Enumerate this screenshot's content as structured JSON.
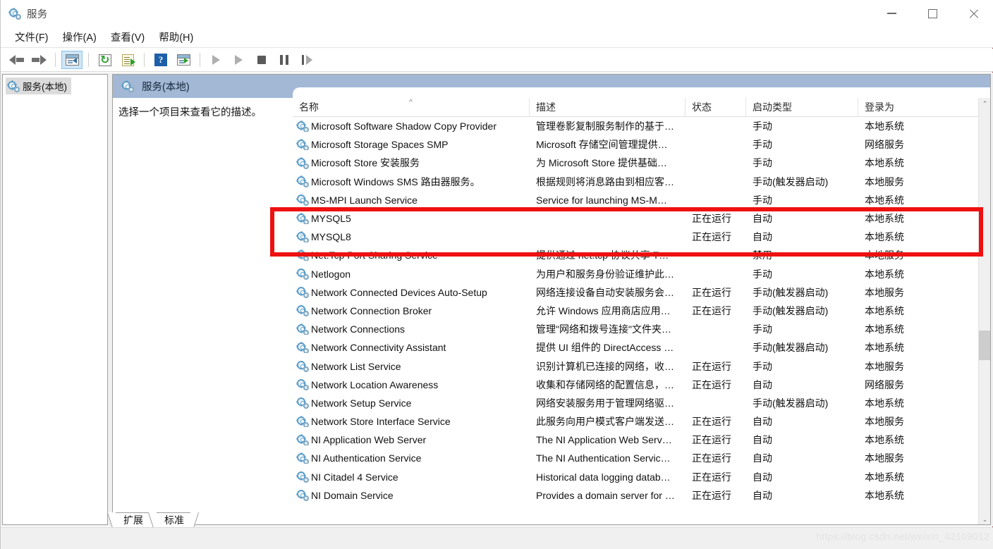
{
  "window": {
    "title": "服务",
    "icon": "services-gear-icon",
    "controls": {
      "minimize": "最小化",
      "maximize": "最大化",
      "close": "关闭"
    }
  },
  "menubar": {
    "items": [
      {
        "label": "文件(F)",
        "name": "menu-file"
      },
      {
        "label": "操作(A)",
        "name": "menu-action"
      },
      {
        "label": "查看(V)",
        "name": "menu-view"
      },
      {
        "label": "帮助(H)",
        "name": "menu-help"
      }
    ]
  },
  "toolbar": {
    "buttons": [
      {
        "name": "back-arrow-icon",
        "glyph": "left-arrow"
      },
      {
        "name": "forward-arrow-icon",
        "glyph": "right-arrow"
      },
      {
        "name": "show-hide-console-tree-icon",
        "glyph": "window-pane",
        "active": true
      },
      {
        "name": "refresh-icon",
        "glyph": "refresh"
      },
      {
        "name": "export-list-icon",
        "glyph": "export"
      },
      {
        "name": "help-icon",
        "glyph": "help"
      },
      {
        "name": "properties-icon",
        "glyph": "window-play"
      },
      {
        "name": "start-service-icon",
        "glyph": "play"
      },
      {
        "name": "resume-service-icon",
        "glyph": "play-outline"
      },
      {
        "name": "stop-service-icon",
        "glyph": "stop"
      },
      {
        "name": "pause-service-icon",
        "glyph": "pause"
      },
      {
        "name": "restart-service-icon",
        "glyph": "step"
      }
    ]
  },
  "tree": {
    "root_label": "服务(本地)"
  },
  "detail": {
    "header_label": "服务(本地)",
    "description_placeholder": "选择一个项目来查看它的描述。"
  },
  "list": {
    "columns": [
      {
        "key": "name",
        "label": "名称",
        "sorted": true
      },
      {
        "key": "desc",
        "label": "描述"
      },
      {
        "key": "state",
        "label": "状态"
      },
      {
        "key": "start",
        "label": "启动类型"
      },
      {
        "key": "logon",
        "label": "登录为"
      }
    ],
    "rows": [
      {
        "name": "Microsoft Software Shadow Copy Provider",
        "desc": "管理卷影复制服务制作的基于…",
        "state": "",
        "start": "手动",
        "logon": "本地系统"
      },
      {
        "name": "Microsoft Storage Spaces SMP",
        "desc": "Microsoft 存储空间管理提供…",
        "state": "",
        "start": "手动",
        "logon": "网络服务"
      },
      {
        "name": "Microsoft Store 安装服务",
        "desc": "为 Microsoft Store 提供基础…",
        "state": "",
        "start": "手动",
        "logon": "本地系统"
      },
      {
        "name": "Microsoft Windows SMS 路由器服务。",
        "desc": "根据规则将消息路由到相应客…",
        "state": "",
        "start": "手动(触发器启动)",
        "logon": "本地服务"
      },
      {
        "name": "MS-MPI Launch Service",
        "desc": "Service for launching MS-M…",
        "state": "",
        "start": "手动",
        "logon": "本地系统"
      },
      {
        "name": "MYSQL5",
        "desc": "",
        "state": "正在运行",
        "start": "自动",
        "logon": "本地系统",
        "highlighted": true
      },
      {
        "name": "MYSQL8",
        "desc": "",
        "state": "正在运行",
        "start": "自动",
        "logon": "本地系统",
        "highlighted": true
      },
      {
        "name": "Net.Tcp Port Sharing Service",
        "desc": "提供通过 net.tcp 协议共享 T…",
        "state": "",
        "start": "禁用",
        "logon": "本地服务"
      },
      {
        "name": "Netlogon",
        "desc": "为用户和服务身份验证维护此…",
        "state": "",
        "start": "手动",
        "logon": "本地系统"
      },
      {
        "name": "Network Connected Devices Auto-Setup",
        "desc": "网络连接设备自动安装服务会…",
        "state": "正在运行",
        "start": "手动(触发器启动)",
        "logon": "本地服务"
      },
      {
        "name": "Network Connection Broker",
        "desc": "允许 Windows 应用商店应用…",
        "state": "正在运行",
        "start": "手动(触发器启动)",
        "logon": "本地系统"
      },
      {
        "name": "Network Connections",
        "desc": "管理\"网络和拨号连接\"文件夹…",
        "state": "",
        "start": "手动",
        "logon": "本地系统"
      },
      {
        "name": "Network Connectivity Assistant",
        "desc": "提供 UI 组件的 DirectAccess …",
        "state": "",
        "start": "手动(触发器启动)",
        "logon": "本地系统"
      },
      {
        "name": "Network List Service",
        "desc": "识别计算机已连接的网络，收…",
        "state": "正在运行",
        "start": "手动",
        "logon": "本地服务"
      },
      {
        "name": "Network Location Awareness",
        "desc": "收集和存储网络的配置信息，…",
        "state": "正在运行",
        "start": "自动",
        "logon": "网络服务"
      },
      {
        "name": "Network Setup Service",
        "desc": "网络安装服务用于管理网络驱…",
        "state": "",
        "start": "手动(触发器启动)",
        "logon": "本地系统"
      },
      {
        "name": "Network Store Interface Service",
        "desc": "此服务向用户模式客户端发送…",
        "state": "正在运行",
        "start": "自动",
        "logon": "本地服务"
      },
      {
        "name": "NI Application Web Server",
        "desc": "The NI Application Web Serv…",
        "state": "正在运行",
        "start": "自动",
        "logon": "本地系统"
      },
      {
        "name": "NI Authentication Service",
        "desc": "The NI Authentication Servic…",
        "state": "正在运行",
        "start": "自动",
        "logon": "本地服务"
      },
      {
        "name": "NI Citadel 4 Service",
        "desc": "Historical data logging datab…",
        "state": "正在运行",
        "start": "自动",
        "logon": "本地系统"
      },
      {
        "name": "NI Domain Service",
        "desc": "Provides a domain server for …",
        "state": "正在运行",
        "start": "自动",
        "logon": "本地系统"
      }
    ]
  },
  "tabs": [
    {
      "label": "扩展",
      "name": "tab-extended",
      "selected": false
    },
    {
      "label": "标准",
      "name": "tab-standard",
      "selected": true
    }
  ],
  "scrollbar": {
    "up_glyph": "⌃",
    "down_glyph": "⌄"
  },
  "statusbar": {
    "watermark": "https://blog.csdn.net/weixin_42109012"
  },
  "annotation": {
    "color": "#ee1111",
    "target_rows": [
      "MYSQL5",
      "MYSQL8"
    ]
  }
}
